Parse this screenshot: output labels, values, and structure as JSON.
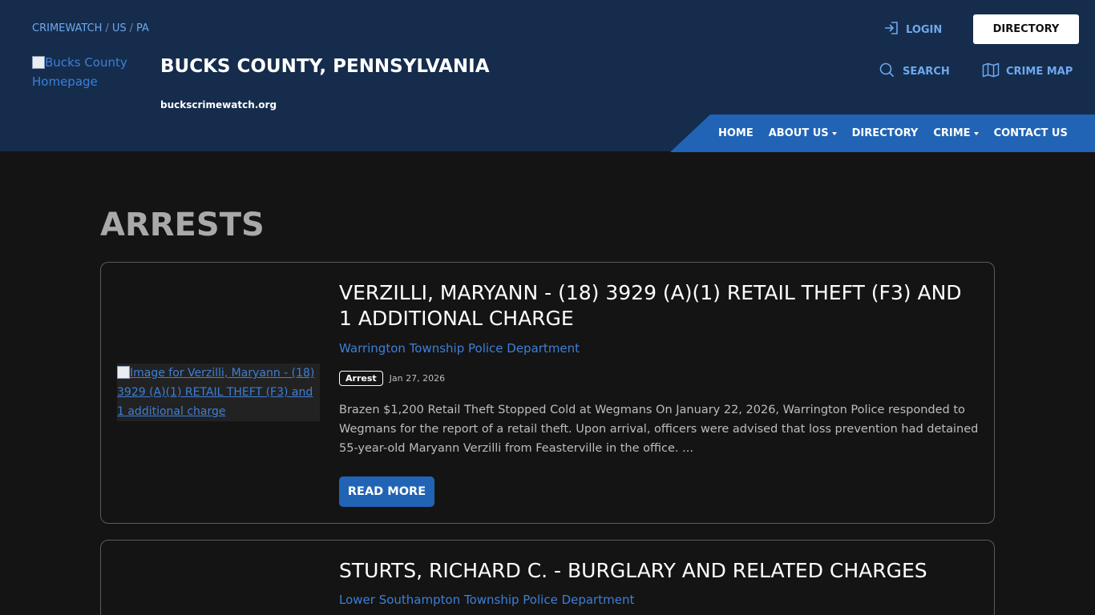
{
  "header": {
    "breadcrumb": [
      "CRIMEWATCH",
      "US",
      "PA"
    ],
    "logo_alt": "Bucks County Homepage",
    "site_title": "BUCKS COUNTY, PENNSYLVANIA",
    "site_url": "buckscrimewatch.org",
    "login_label": "LOGIN",
    "directory_button": "DIRECTORY",
    "search_label": "SEARCH",
    "crime_map_label": "CRIME MAP"
  },
  "nav": {
    "items": [
      {
        "label": "HOME"
      },
      {
        "label": "ABOUT US"
      },
      {
        "label": "DIRECTORY"
      },
      {
        "label": "CRIME"
      },
      {
        "label": "CONTACT US"
      }
    ]
  },
  "main": {
    "heading": "ARRESTS",
    "posts": [
      {
        "image_alt": "Image for Verzilli, Maryann - (18) 3929 (A)(1) RETAIL THEFT (F3) and 1 additional charge",
        "title": "VERZILLI, MARYANN - (18) 3929 (A)(1) RETAIL THEFT (F3) AND 1 ADDITIONAL CHARGE",
        "department": "Warrington Township Police Department",
        "badge": "Arrest",
        "date": "Jan 27, 2026",
        "excerpt": "Brazen $1,200 Retail Theft Stopped Cold at Wegmans On January 22, 2026, Warrington Police responded to Wegmans for the report of a retail theft. Upon arrival, officers were advised that loss prevention had detained 55-year-old Maryann Verzilli from Feasterville in the office. ...",
        "read_more": "READ MORE"
      },
      {
        "title": "STURTS, RICHARD C. - BURGLARY AND RELATED CHARGES",
        "department": "Lower Southampton Township Police Department"
      }
    ]
  },
  "colors": {
    "header_bg": "#152c4c",
    "nav_bg": "#2164b5",
    "accent_link": "#3d7fd8",
    "page_bg": "#141414"
  }
}
